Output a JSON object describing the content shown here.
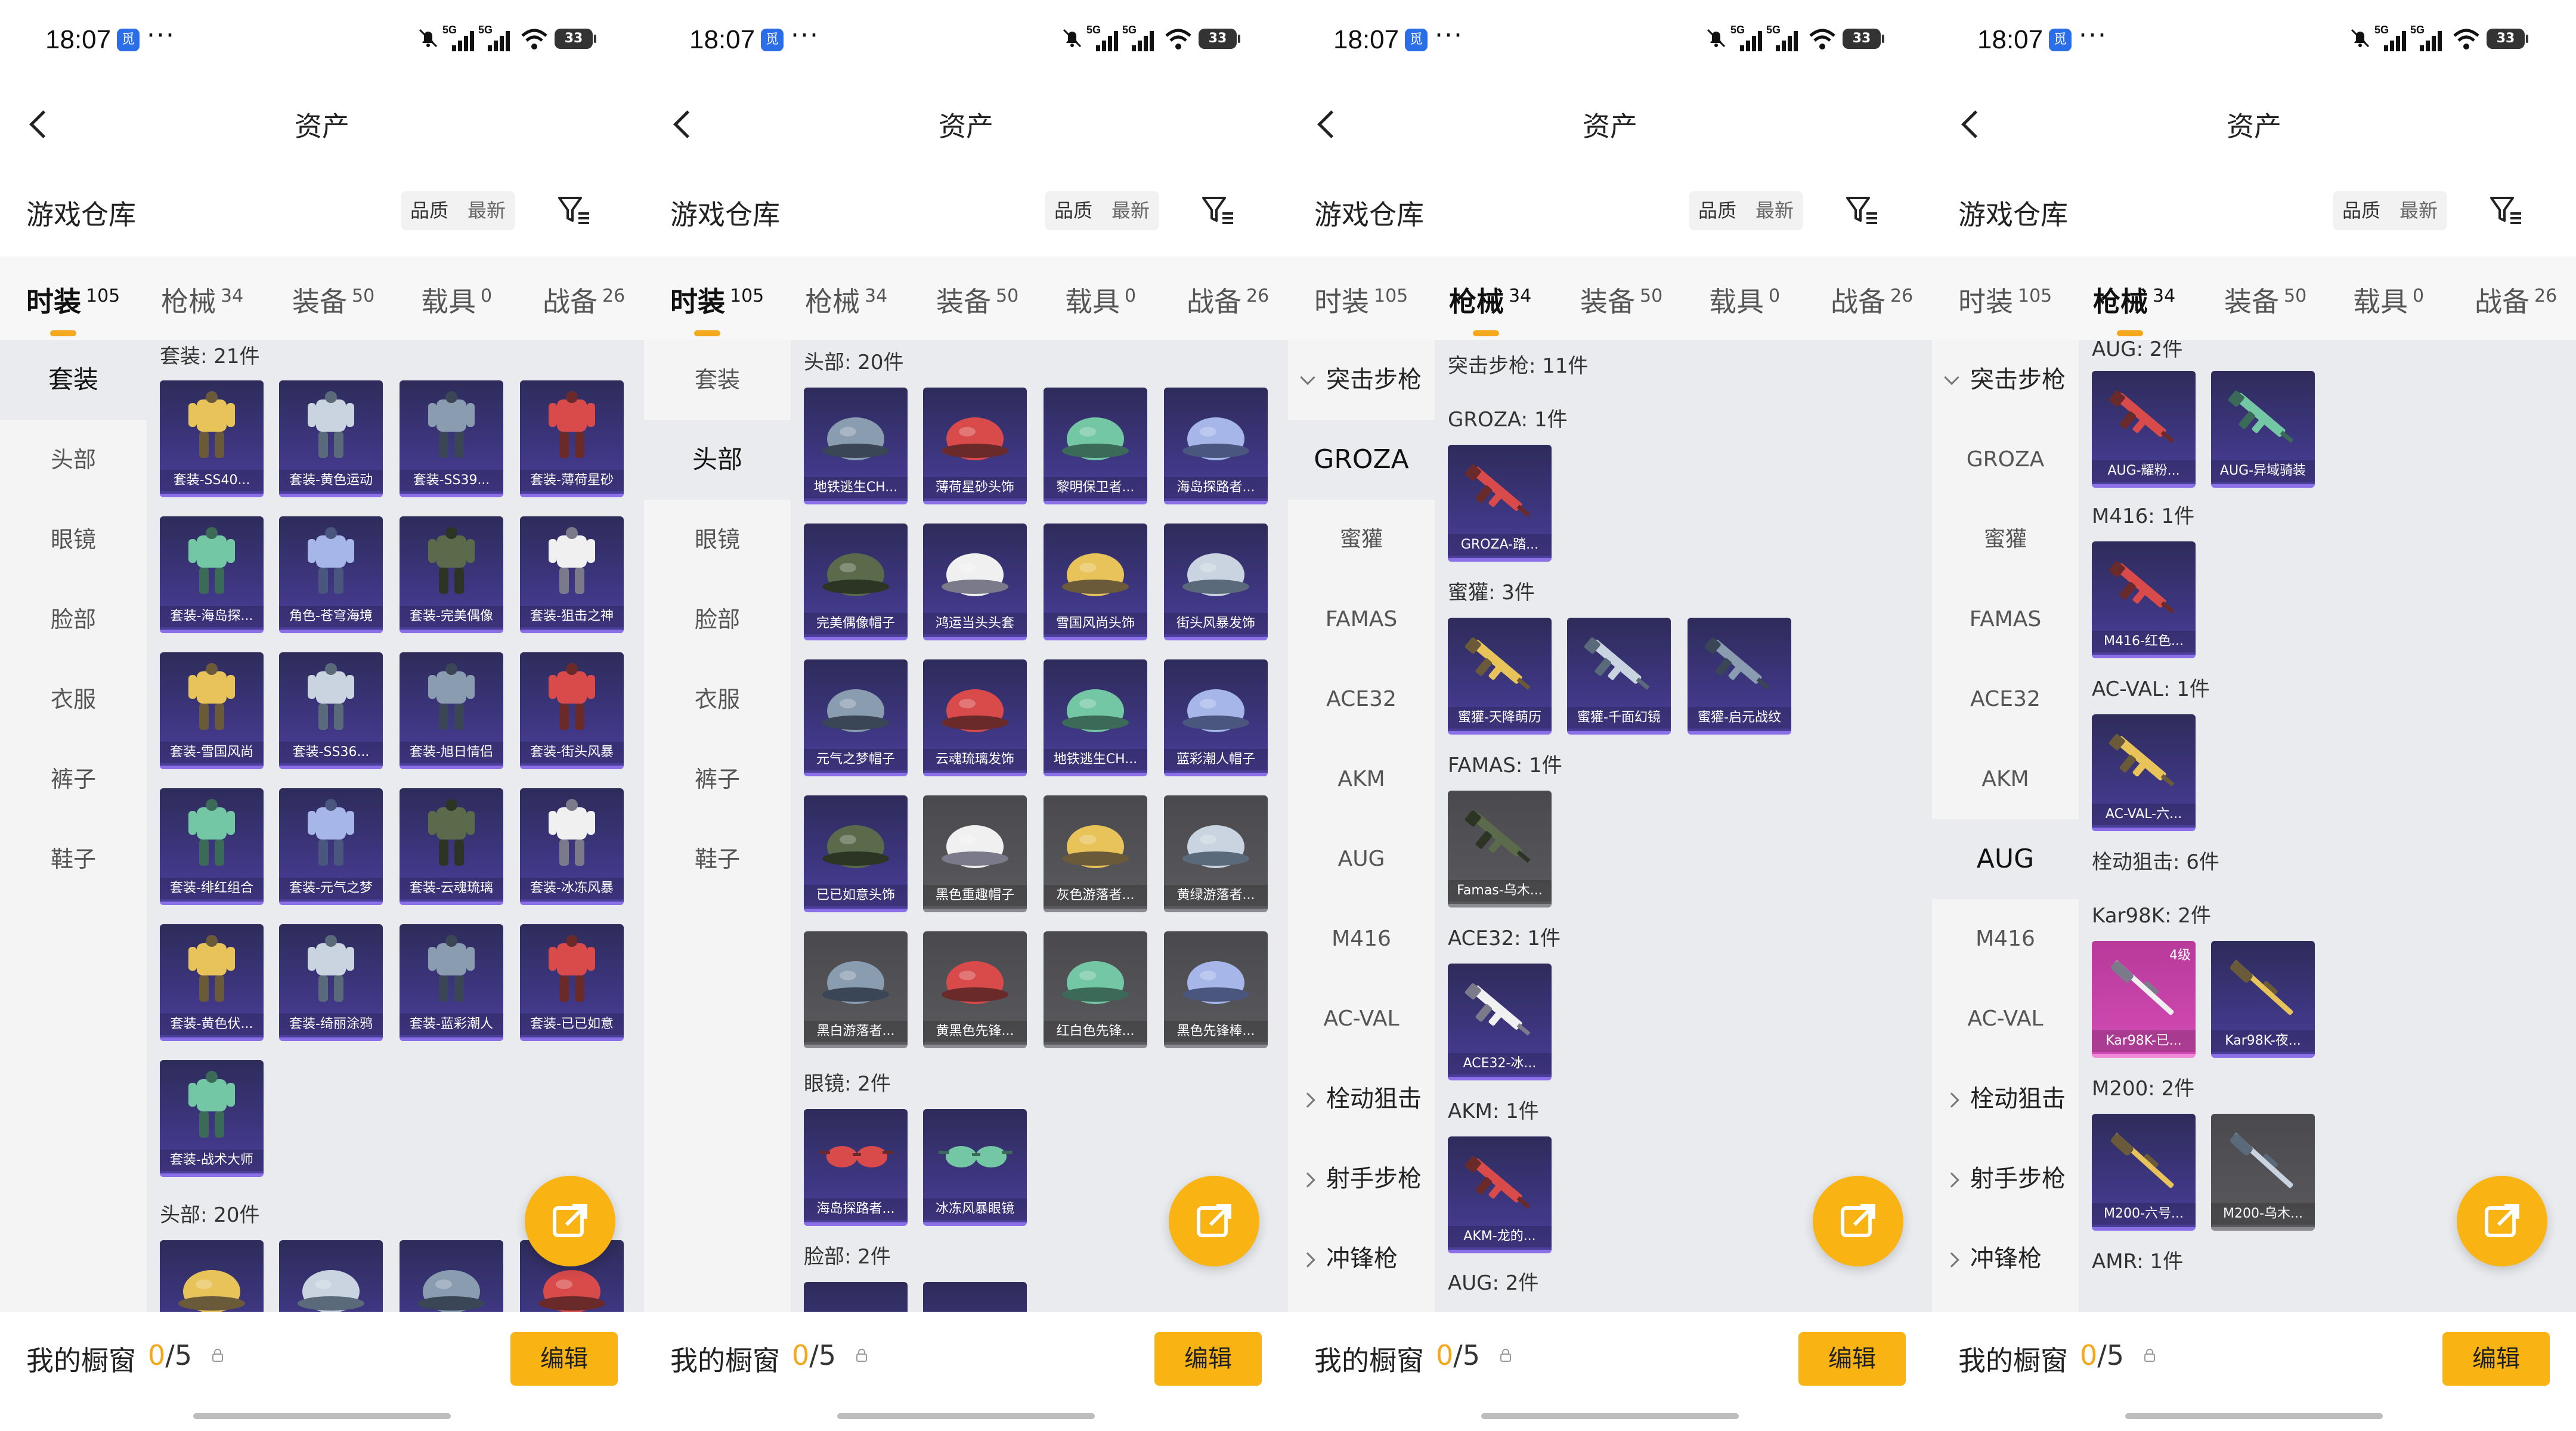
{
  "status": {
    "time": "18:07",
    "app_badge": "觅",
    "dots": "···",
    "net1": "5G",
    "net2": "5G",
    "battery": "33"
  },
  "header": {
    "title": "资产"
  },
  "warehouse": {
    "title": "游戏仓库",
    "sort_quality": "品质",
    "sort_latest": "最新"
  },
  "tabs": [
    {
      "label": "时装",
      "count": "105"
    },
    {
      "label": "枪械",
      "count": "34"
    },
    {
      "label": "装备",
      "count": "50"
    },
    {
      "label": "载具",
      "count": "0"
    },
    {
      "label": "战备",
      "count": "26"
    }
  ],
  "fashion_sidebar": [
    "套装",
    "头部",
    "眼镜",
    "脸部",
    "衣服",
    "裤子",
    "鞋子"
  ],
  "gun_sidebar": {
    "category_ar": "突击步枪",
    "guns": [
      "GROZA",
      "蜜獾",
      "FAMAS",
      "ACE32",
      "AKM",
      "AUG",
      "M416",
      "AC-VAL"
    ],
    "category_sr": "栓动狙击",
    "category_dmr": "射手步枪",
    "category_smg": "冲锋枪"
  },
  "screen1": {
    "sec_suit": "套装: 21件",
    "suits": [
      "套装-SS40...",
      "套装-黄色运动",
      "套装-SS39...",
      "套装-薄荷星砂",
      "套装-海岛探...",
      "角色-苍穹海境",
      "套装-完美偶像",
      "套装-狙击之神",
      "套装-雪国风尚",
      "套装-SS36...",
      "套装-旭日情侣",
      "套装-街头风暴",
      "套装-绯红组合",
      "套装-元气之梦",
      "套装-云魂琉璃",
      "套装-冰冻风暴",
      "套装-黄色伏...",
      "套装-绮丽涂鸦",
      "套装-蓝彩潮人",
      "套装-已已如意",
      "套装-战术大师"
    ],
    "sec_head": "头部: 20件"
  },
  "screen2": {
    "sec_head": "头部: 20件",
    "heads": [
      "地铁逃生CH...",
      "薄荷星砂头饰",
      "黎明保卫者...",
      "海岛探路者...",
      "完美偶像帽子",
      "鸿运当头头套",
      "雪国风尚头饰",
      "街头风暴发饰",
      "元气之梦帽子",
      "云魂琉璃发饰",
      "地铁逃生CH...",
      "蓝彩潮人帽子",
      "已已如意头饰",
      "黑色重趣帽子",
      "灰色游落者...",
      "黄绿游落者...",
      "黑白游落者...",
      "黄黑色先锋...",
      "红白色先锋...",
      "黑色先锋棒..."
    ],
    "sec_glasses": "眼镜: 2件",
    "glasses": [
      "海岛探路者...",
      "冰冻风暴眼镜"
    ],
    "sec_face": "脸部: 2件"
  },
  "screen3": {
    "sec_ar": "突击步枪: 11件",
    "sec_groza": "GROZA: 1件",
    "groza": [
      "GROZA-踏..."
    ],
    "sec_mihuan": "蜜獾: 3件",
    "mihuan": [
      "蜜獾-天降萌历",
      "蜜獾-千面幻镜",
      "蜜獾-启元战纹"
    ],
    "sec_famas": "FAMAS: 1件",
    "famas": [
      "Famas-乌木..."
    ],
    "sec_ace": "ACE32: 1件",
    "ace": [
      "ACE32-冰..."
    ],
    "sec_akm": "AKM: 1件",
    "akm": [
      "AKM-龙的..."
    ],
    "sec_aug": "AUG: 2件"
  },
  "screen4": {
    "sec_aug": "AUG: 2件",
    "aug": [
      "AUG-耀粉...",
      "AUG-异域骑装"
    ],
    "sec_m416": "M416: 1件",
    "m416": [
      "M416-红色..."
    ],
    "sec_acval": "AC-VAL: 1件",
    "acval": [
      "AC-VAL-六..."
    ],
    "sec_sr": "栓动狙击: 6件",
    "sec_kar": "Kar98K: 2件",
    "kar": [
      "Kar98K-已...",
      "Kar98K-夜..."
    ],
    "kar_level": "4级",
    "sec_m200": "M200: 2件",
    "m200": [
      "M200-六号...",
      "M200-乌木..."
    ],
    "sec_amr": "AMR: 1件"
  },
  "bottom": {
    "label": "我的橱窗",
    "count_num": "0",
    "count_total": "/5",
    "edit": "编辑"
  },
  "colors": {
    "accent": "#f9b414",
    "tab_indicator": "#f5a81c",
    "card_purple": "#3d3680",
    "card_gray": "#56565a",
    "card_pink": "#c843a8"
  }
}
